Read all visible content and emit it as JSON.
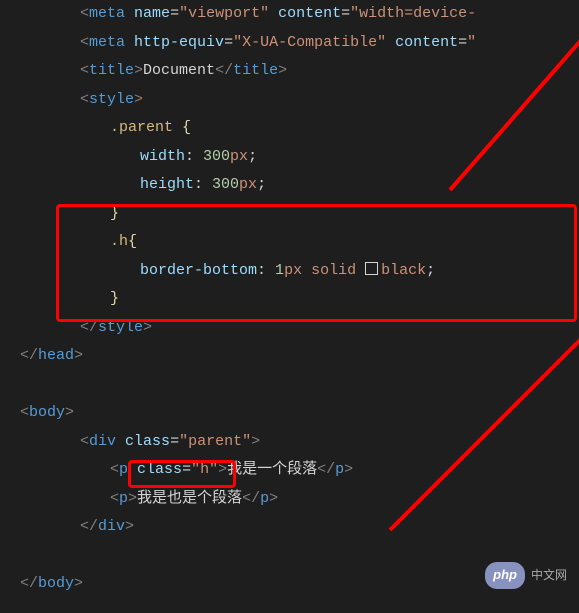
{
  "code": {
    "metaViewportTag": "meta",
    "metaViewportAttr": "name",
    "metaViewportVal": "\"viewport\"",
    "metaViewportAttr2": "content",
    "metaViewportVal2": "\"width=device-",
    "metaHttpTag": "meta",
    "metaHttpAttr": "http-equiv",
    "metaHttpVal": "\"X-UA-Compatible\"",
    "metaHttpAttr2": "content",
    "metaHttpVal2": "\"",
    "titleTag": "title",
    "titleText": "Document",
    "styleTag": "style",
    "selector1": ".parent",
    "prop1": "width",
    "val1num": "300",
    "val1unit": "px",
    "prop2": "height",
    "val2num": "300",
    "val2unit": "px",
    "selector2": ".h",
    "prop3": "border-bottom",
    "val3a": "1",
    "val3aunit": "px",
    "val3b": "solid",
    "val3c": "black",
    "headTag": "head",
    "bodyTag": "body",
    "divTag": "div",
    "classAttr": "class",
    "classParent": "\"parent\"",
    "pTag": "p",
    "classH": "\"h\"",
    "pText1": "我是一个段落",
    "pText2": "我是也是个段落"
  },
  "watermark": {
    "logo": "php",
    "text": "中文网"
  }
}
